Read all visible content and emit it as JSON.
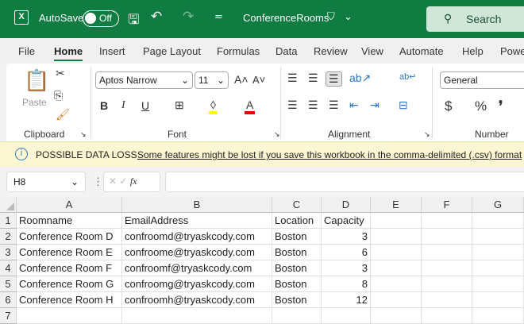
{
  "title_bar": {
    "autosave": "AutoSave",
    "autosave_state": "Off",
    "file_name": "ConferenceRooms",
    "search": "Search"
  },
  "tabs": [
    "File",
    "Home",
    "Insert",
    "Page Layout",
    "Formulas",
    "Data",
    "Review",
    "View",
    "Automate",
    "Help",
    "Powe"
  ],
  "active_tab": "Home",
  "ribbon": {
    "paste": "Paste",
    "clipboard": "Clipboard",
    "font_name": "Aptos Narrow",
    "font_size": "11",
    "font": "Font",
    "alignment": "Alignment",
    "number_format": "General",
    "number": "Number",
    "bold": "B",
    "italic": "I",
    "underline": "U",
    "currency": "$",
    "percent": "%",
    "comma": "❜"
  },
  "info_bar": {
    "title": "POSSIBLE DATA LOSS",
    "message": "Some features might be lost if you save this workbook in the comma-delimited (.csv) format"
  },
  "formula_bar": {
    "name_box": "H8",
    "fx": "fx",
    "formula": ""
  },
  "columns": [
    "A",
    "B",
    "C",
    "D",
    "E",
    "F",
    "G"
  ],
  "rows": [
    "1",
    "2",
    "3",
    "4",
    "5",
    "6",
    "7"
  ],
  "cells": [
    [
      "Roomname",
      "EmailAddress",
      "Location",
      "Capacity"
    ],
    [
      "Conference Room D",
      "confroomd@tryaskcody.com",
      "Boston",
      "3"
    ],
    [
      "Conference Room E",
      "confroome@tryaskcody.com",
      "Boston",
      "6"
    ],
    [
      "Conference Room F",
      "confroomf@tryaskcody.com",
      "Boston",
      "3"
    ],
    [
      "Conference Room G",
      "confroomg@tryaskcody.com",
      "Boston",
      "8"
    ],
    [
      "Conference Room H",
      "confroomh@tryaskcody.com",
      "Boston",
      "12"
    ]
  ],
  "colors": {
    "brand": "#107c41",
    "info_bg": "#fdf6d3"
  }
}
